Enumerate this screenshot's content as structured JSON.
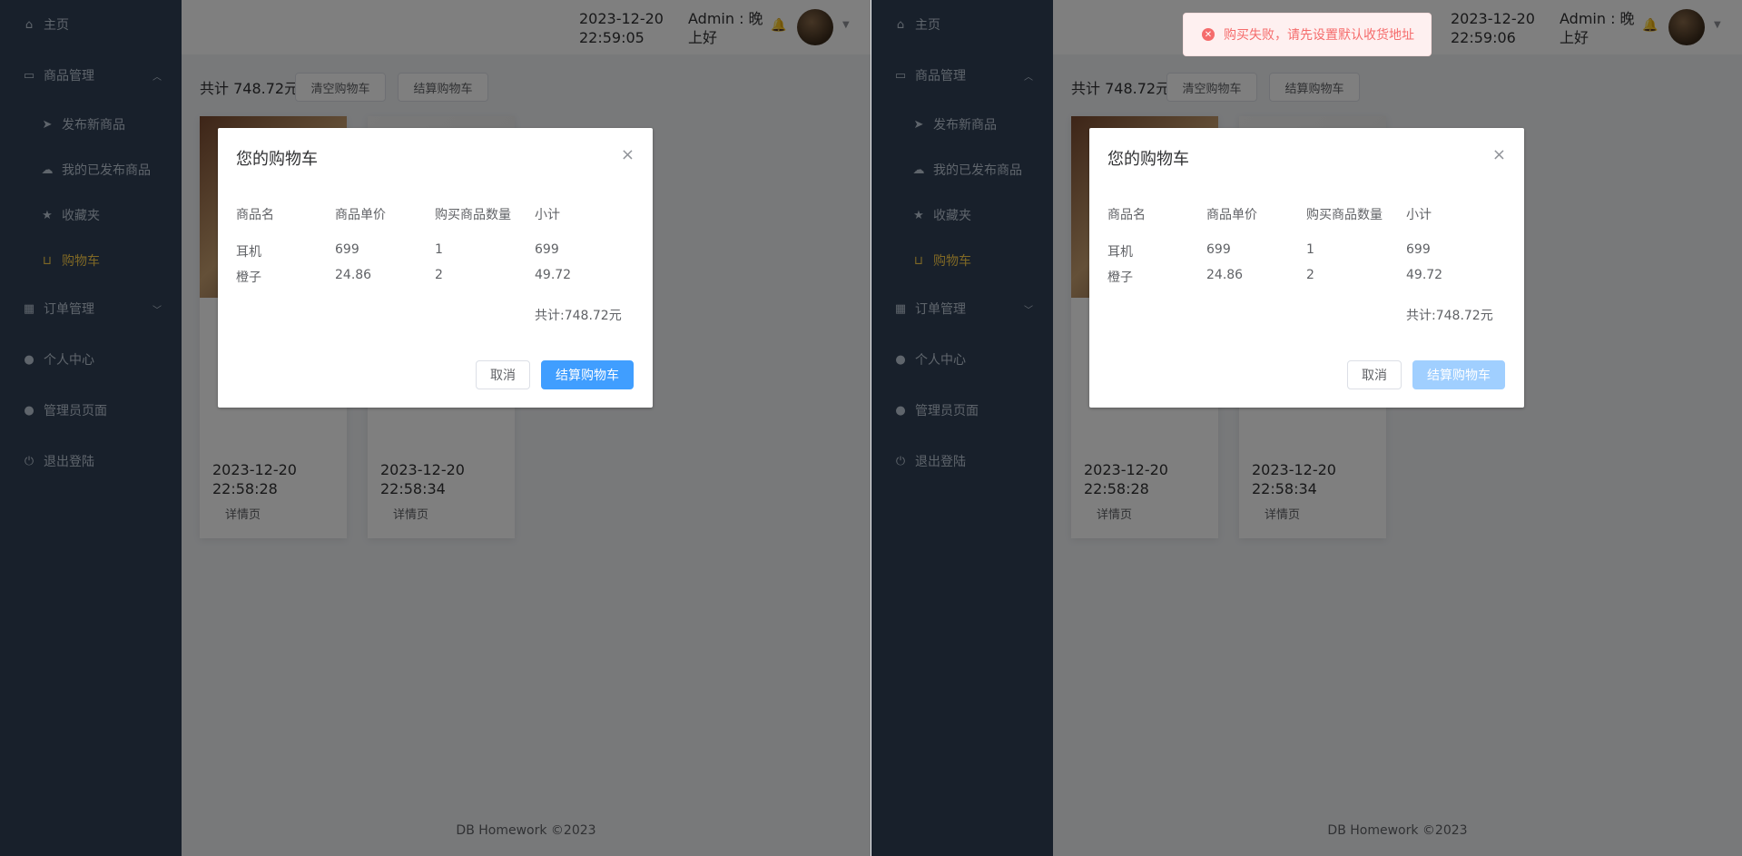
{
  "colors": {
    "sidebar_bg": "#304156",
    "active_item": "#ffd04b",
    "primary": "#409eff",
    "error": "#f56c6c"
  },
  "sidebar": {
    "items": [
      {
        "label": "主页",
        "icon": "home-icon"
      },
      {
        "label": "商品管理",
        "icon": "bag-icon"
      },
      {
        "label": "发布新商品",
        "icon": "send-icon"
      },
      {
        "label": "我的已发布商品",
        "icon": "cloud-upload-icon"
      },
      {
        "label": "收藏夹",
        "icon": "star-icon"
      },
      {
        "label": "购物车",
        "icon": "cart-icon"
      },
      {
        "label": "订单管理",
        "icon": "calendar-icon"
      },
      {
        "label": "个人中心",
        "icon": "user-icon"
      },
      {
        "label": "管理员页面",
        "icon": "user-icon"
      },
      {
        "label": "退出登陆",
        "icon": "power-icon"
      }
    ]
  },
  "header": {
    "left_datetime": "2023-12-20 22:59:05",
    "right_datetime": "2023-12-20 22:59:06",
    "greeting": "Admin : 晚上好"
  },
  "main": {
    "total_text": "共计 748.72元",
    "clear_button": "清空购物车",
    "checkout_button": "结算购物车",
    "cards": [
      {
        "datetime": "2023-12-20 22:58:28",
        "detail_label": "详情页"
      },
      {
        "datetime": "2023-12-20 22:58:34",
        "detail_label": "详情页"
      }
    ],
    "footer": "DB Homework ©2023"
  },
  "dialog": {
    "title": "您的购物车",
    "headers": [
      "商品名",
      "商品单价",
      "购买商品数量",
      "小计"
    ],
    "rows": [
      {
        "name": "耳机",
        "price": "699",
        "qty": "1",
        "subtotal": "699"
      },
      {
        "name": "橙子",
        "price": "24.86",
        "qty": "2",
        "subtotal": "49.72"
      }
    ],
    "sum": "共计:748.72元",
    "cancel": "取消",
    "confirm": "结算购物车"
  },
  "toast": {
    "message": "购买失败，请先设置默认收货地址"
  }
}
